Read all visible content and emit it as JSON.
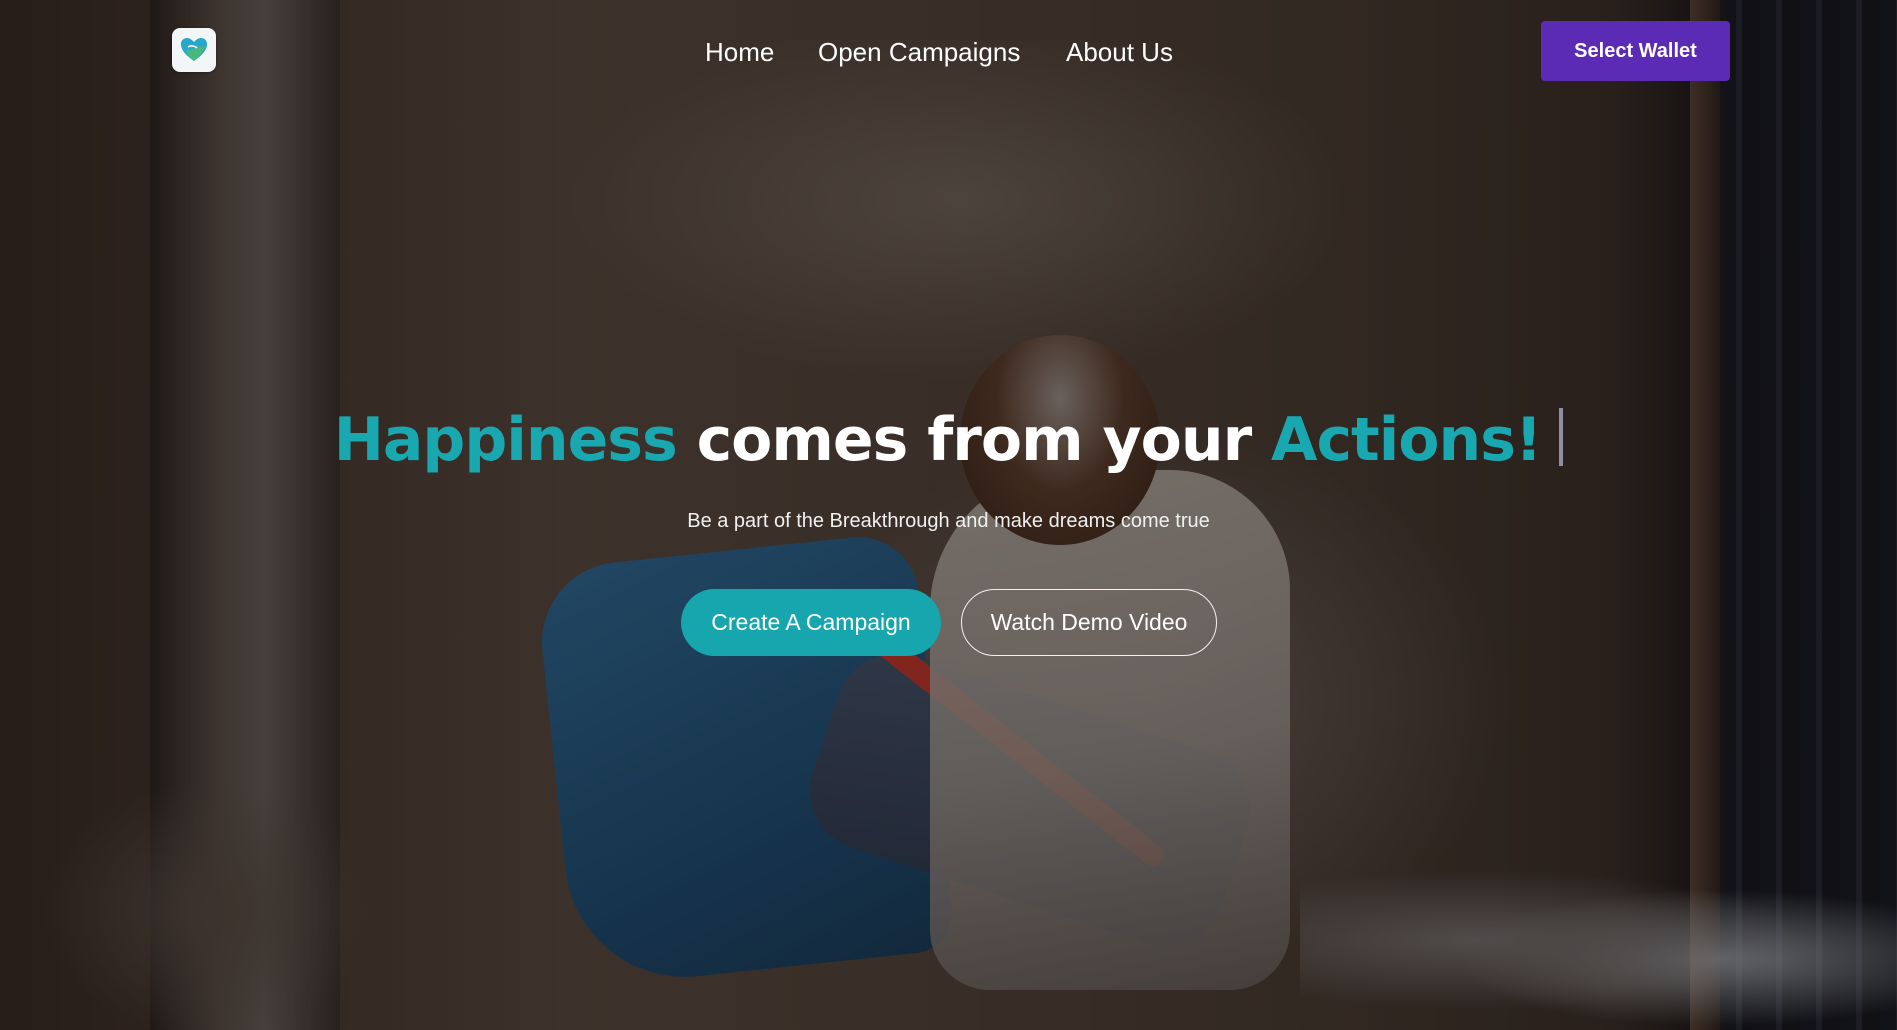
{
  "brand": {
    "logo_icon": "heart-hands-logo-icon"
  },
  "nav": {
    "items": [
      {
        "label": "Home"
      },
      {
        "label": "Open Campaigns"
      },
      {
        "label": "About Us"
      }
    ],
    "wallet_button": "Select Wallet"
  },
  "hero": {
    "headline_part1": "Happiness",
    "headline_part2": " comes from your ",
    "headline_part3": "Actions!",
    "subtitle": "Be a part of the Breakthrough and make dreams come true",
    "primary_cta": "Create A Campaign",
    "secondary_cta": "Watch Demo Video"
  },
  "colors": {
    "accent_teal": "#17a6ad",
    "wallet_purple": "#5b2bb5"
  }
}
